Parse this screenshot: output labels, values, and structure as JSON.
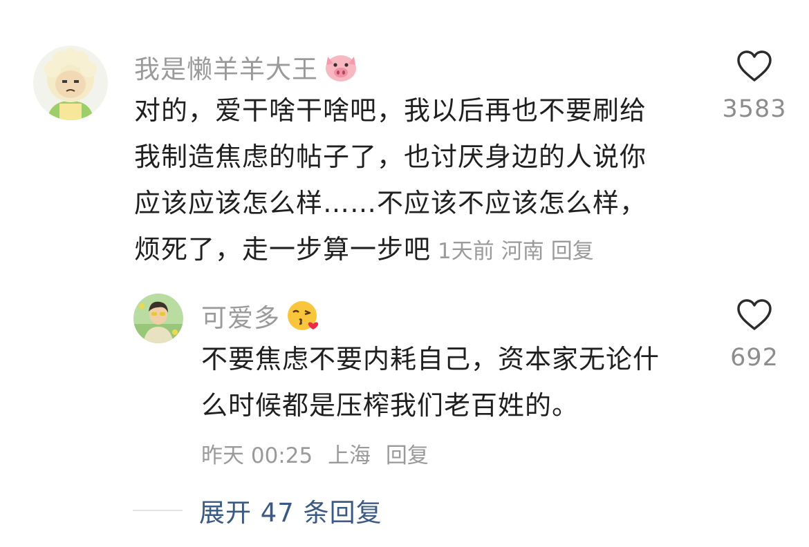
{
  "comments": [
    {
      "username": "我是懒羊羊大王",
      "emoji": "pig-face",
      "content_lines": [
        "对的，爱干啥干啥吧，我以后再也不要刷给",
        "我制造焦虑的帖子了，也讨厌身边的人说你",
        "应该应该怎么样……不应该不应该怎么样，",
        "烦死了，走一步算一步吧"
      ],
      "time": "1天前",
      "location": "河南",
      "reply_label": "回复",
      "like_count": "3583"
    },
    {
      "username": "可爱多",
      "emoji": "face-blowing-a-kiss",
      "content_lines": [
        "不要焦虑不要内耗自己，资本家无论什",
        "么时候都是压榨我们老百姓的。"
      ],
      "time": "昨天 00:25",
      "location": "上海",
      "reply_label": "回复",
      "like_count": "692"
    }
  ],
  "expand_replies": "展开 47 条回复",
  "colors": {
    "username": "#9a9a9a",
    "text": "#1f1f1f",
    "meta": "#9a9a9a",
    "link": "#3a5a85"
  }
}
